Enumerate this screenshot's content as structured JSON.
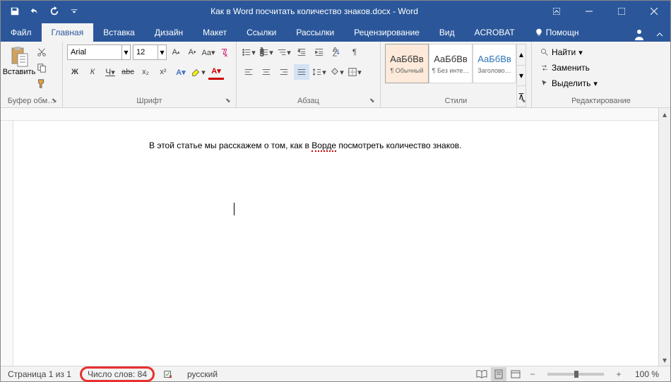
{
  "title": "Как в Word посчитать количество знаков.docx - Word",
  "tabs": {
    "file": "Файл",
    "home": "Главная",
    "insert": "Вставка",
    "design": "Дизайн",
    "layout": "Макет",
    "references": "Ссылки",
    "mailings": "Рассылки",
    "review": "Рецензирование",
    "view": "Вид",
    "acrobat": "ACROBAT",
    "tell_me": "Помощн"
  },
  "ribbon": {
    "clipboard": {
      "label": "Буфер обм…",
      "paste": "Вставить"
    },
    "font": {
      "label": "Шрифт",
      "name": "Arial",
      "size": "12",
      "bold": "Ж",
      "italic": "К",
      "underline": "Ч",
      "strike": "abc",
      "sub": "x₂",
      "sup": "x²"
    },
    "paragraph": {
      "label": "Абзац"
    },
    "styles": {
      "label": "Стили",
      "items": [
        {
          "preview": "АаБбВв",
          "name": "¶ Обычный"
        },
        {
          "preview": "АаБбВв",
          "name": "¶ Без инте…"
        },
        {
          "preview": "АаБбВв",
          "name": "Заголово…"
        }
      ]
    },
    "editing": {
      "label": "Редактирование",
      "find": "Найти",
      "replace": "Заменить",
      "select": "Выделить"
    }
  },
  "document": {
    "text_before": "В этой статье мы расскажем о том, как в ",
    "text_underlined": "Ворде",
    "text_after": " посмотреть количество знаков."
  },
  "statusbar": {
    "page": "Страница 1 из 1",
    "words": "Число слов: 84",
    "language": "русский",
    "zoom": "100 %"
  }
}
